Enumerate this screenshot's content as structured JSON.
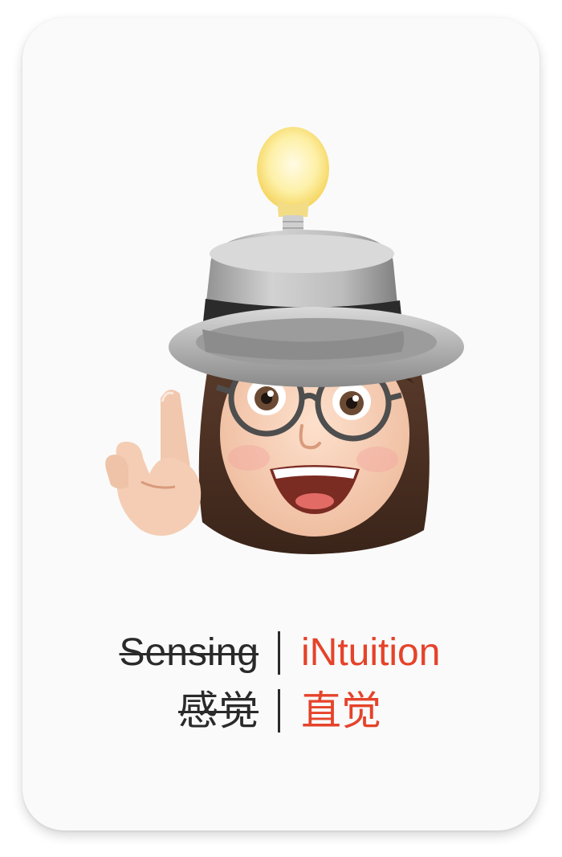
{
  "card": {
    "english": {
      "left_label": "Sensing",
      "right_label": "iNtuition"
    },
    "chinese": {
      "left_label": "感觉",
      "right_label": "直觉"
    }
  },
  "colors": {
    "accent": "#e5432a",
    "text_dark": "#2a2a2a",
    "card_bg": "#fafafa"
  },
  "illustration": {
    "icon": "memoji-lightbulb-hat-avatar"
  }
}
